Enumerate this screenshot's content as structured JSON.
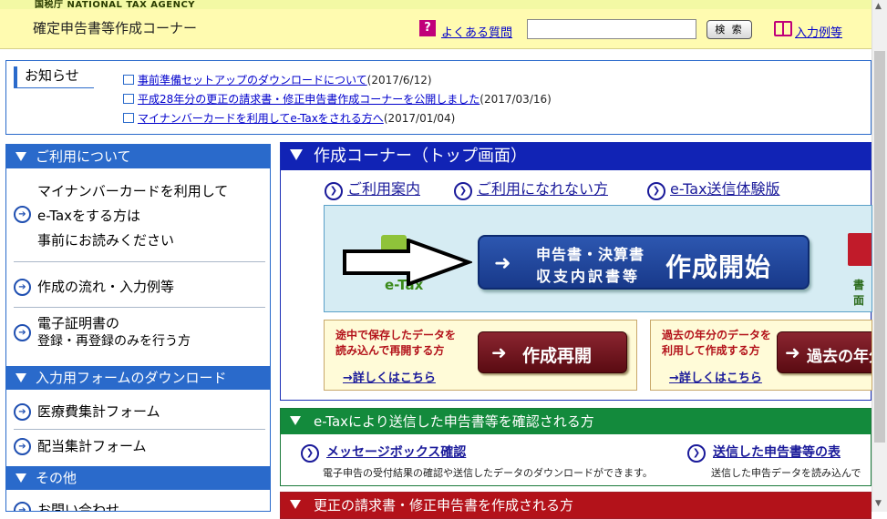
{
  "header": {
    "agency": "国税庁  NATIONAL TAX AGENCY",
    "site_title": "確定申告書等作成コーナー",
    "faq_label": "よくある質問",
    "search_value": "",
    "search_button": "検 索",
    "example_label": "入力例等"
  },
  "news": {
    "title": "お知らせ",
    "items": [
      {
        "link": "事前準備セットアップのダウンロードについて",
        "date": "(2017/6/12)"
      },
      {
        "link": "平成28年分の更正の請求書・修正申告書作成コーナーを公開しました",
        "date": "(2017/03/16)"
      },
      {
        "link": "マイナンバーカードを利用してe-Taxをされる方へ",
        "date": "(2017/01/04)"
      }
    ]
  },
  "sidebar": {
    "sections": [
      {
        "title": "ご利用について"
      },
      {
        "title": "入力用フォームのダウンロード"
      },
      {
        "title": "その他"
      }
    ],
    "items": [
      {
        "line1": "マイナンバーカードを利用して",
        "line2": "e-Taxをする方は",
        "line3": "事前にお読みください"
      },
      {
        "label": "作成の流れ・入力例等"
      },
      {
        "line1": "電子証明書の",
        "line2": "登録・再登録のみを行う方"
      },
      {
        "label": "医療費集計フォーム"
      },
      {
        "label": "配当集計フォーム"
      },
      {
        "label": "お問い合わせ"
      }
    ]
  },
  "main": {
    "title": "作成コーナー（トップ画面）",
    "quick_links": [
      "ご利用案内",
      "ご利用になれない方",
      "e-Tax送信体験版"
    ],
    "etax_logo_text": "e-Tax",
    "start_button": {
      "sub1": "申告書・決算書",
      "sub2": "収支内訳書等",
      "big": "作成開始"
    },
    "side_icon_label": "書面",
    "resume": {
      "desc1": "途中で保存したデータを",
      "desc2": "読み込んで再開する方",
      "button": "作成再開",
      "link": "→詳しくはこちら"
    },
    "past": {
      "desc1": "過去の年分のデータを",
      "desc2": "利用して作成する方",
      "button": "過去の年分",
      "link": "→詳しくはこちら"
    }
  },
  "etax_panel": {
    "title": "e-Taxにより送信した申告書等を確認される方",
    "link1": "メッセージボックス確認",
    "desc1": "電子申告の受付結果の確認や送信したデータのダウンロードができます。",
    "link2": "送信した申告書等の表",
    "desc2": "送信した申告データを読み込んで"
  },
  "amend_panel": {
    "title": "更正の請求書・修正申告書を作成される方"
  }
}
